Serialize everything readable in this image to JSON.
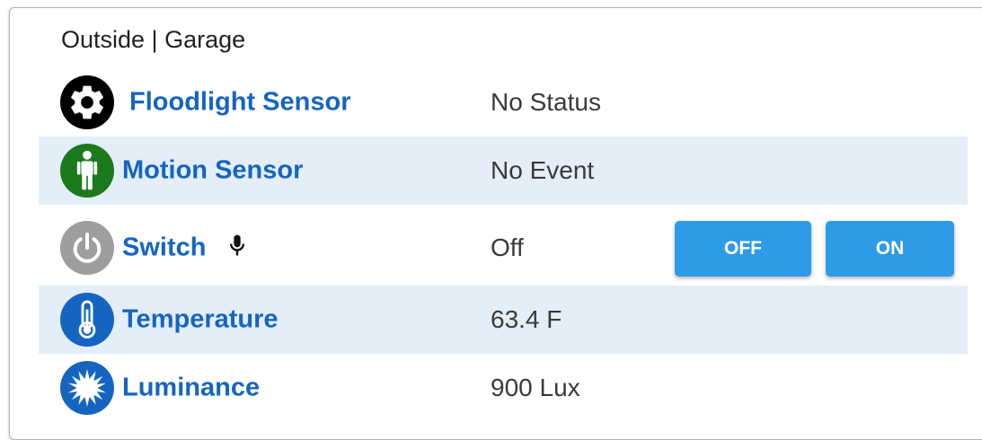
{
  "card": {
    "title": "Outside | Garage"
  },
  "devices": [
    {
      "name": "Floodlight Sensor",
      "status": "No Status",
      "icon": "gear-icon",
      "icon_color": "#000000"
    },
    {
      "name": "Motion Sensor",
      "status": "No Event",
      "icon": "person-icon",
      "icon_color": "#1b7a1b"
    },
    {
      "name": "Switch",
      "status": "Off",
      "icon": "power-icon",
      "icon_color": "#9e9e9e",
      "voice_icon": "microphone-icon",
      "buttons": {
        "off_label": "OFF",
        "on_label": "ON"
      }
    },
    {
      "name": "Temperature",
      "status": "63.4 F",
      "icon": "thermometer-icon",
      "icon_color": "#1565c0"
    },
    {
      "name": "Luminance",
      "status": "900 Lux",
      "icon": "sun-burst-icon",
      "icon_color": "#1565c0"
    }
  ],
  "colors": {
    "link": "#1565c0",
    "button": "#2e9be6",
    "row_alt": "#e3eef8"
  }
}
